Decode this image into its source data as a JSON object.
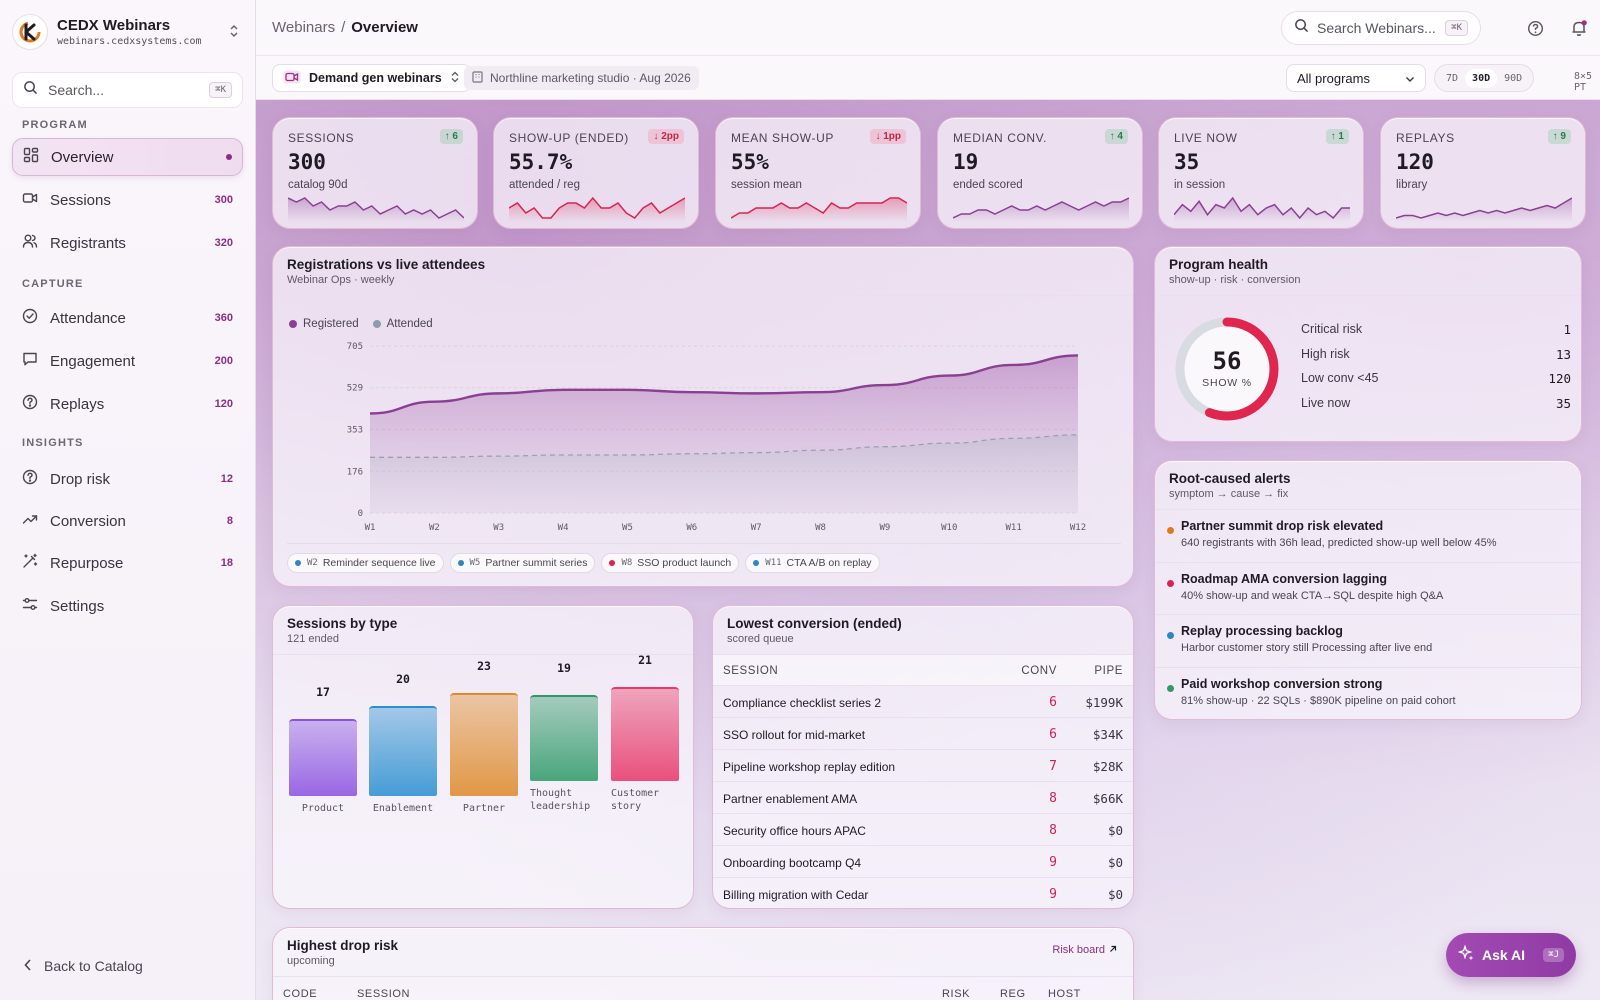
{
  "brand": {
    "name": "CEDX Webinars",
    "url": "webinars.cedxsystems.com"
  },
  "sidebar": {
    "search_placeholder": "Search...",
    "search_kbd": "⌘K",
    "sections": {
      "program": "PROGRAM",
      "capture": "CAPTURE",
      "insights": "INSIGHTS"
    },
    "items": [
      {
        "label": "Overview",
        "count": "",
        "icon": "grid-icon",
        "active": true
      },
      {
        "label": "Sessions",
        "count": "300",
        "icon": "video-icon"
      },
      {
        "label": "Registrants",
        "count": "320",
        "icon": "users-icon"
      },
      {
        "label": "Attendance",
        "count": "360",
        "icon": "check-circle-icon"
      },
      {
        "label": "Engagement",
        "count": "200",
        "icon": "chat-icon"
      },
      {
        "label": "Replays",
        "count": "120",
        "icon": "help-circle-icon"
      },
      {
        "label": "Drop risk",
        "count": "12",
        "icon": "help-circle-icon"
      },
      {
        "label": "Conversion",
        "count": "8",
        "icon": "trend-up-icon"
      },
      {
        "label": "Repurpose",
        "count": "18",
        "icon": "wand-icon"
      },
      {
        "label": "Settings",
        "count": "",
        "icon": "sliders-icon"
      }
    ],
    "back_label": "Back to Catalog"
  },
  "topbar": {
    "breadcrumb": [
      "Webinars",
      "Overview"
    ],
    "search_placeholder": "Search Webinars...",
    "search_kbd": "⌘K"
  },
  "subbar": {
    "workspace": "Demand gen webinars",
    "tenant": "Northline marketing studio · Aug 2026",
    "program_select": "All programs",
    "ranges": [
      "7D",
      "30D",
      "90D"
    ],
    "selected_range": "30D",
    "grid": "8×5 PT"
  },
  "kpis": [
    {
      "label": "SESSIONS",
      "value": "300",
      "caption": "catalog 90d",
      "delta": "↑ 6",
      "dir": "up",
      "color": "#8a3f93",
      "spark": [
        6,
        5,
        6,
        4,
        5,
        3,
        4,
        4,
        5,
        3,
        4,
        2,
        3,
        4,
        2,
        3,
        2,
        3,
        1,
        2,
        3,
        1
      ]
    },
    {
      "label": "SHOW-UP (ENDED)",
      "value": "55.7%",
      "caption": "attended / reg",
      "delta": "↓ 2pp",
      "dir": "down",
      "color": "#d8244e",
      "spark": [
        3,
        4,
        2,
        3,
        1,
        1,
        3,
        4,
        4,
        3,
        5,
        3,
        3,
        4,
        2,
        1,
        3,
        4,
        2,
        3,
        4,
        5
      ]
    },
    {
      "label": "MEAN SHOW-UP",
      "value": "55%",
      "caption": "session mean",
      "delta": "↓ 1pp",
      "dir": "down",
      "color": "#d8244e",
      "spark": [
        1,
        2,
        2,
        3,
        3,
        3,
        4,
        3,
        3,
        4,
        3,
        2,
        4,
        3,
        3,
        4,
        4,
        4,
        4,
        5,
        5,
        4
      ]
    },
    {
      "label": "MEDIAN CONV.",
      "value": "19",
      "caption": "ended scored",
      "delta": "↑ 4",
      "dir": "up",
      "color": "#8a3f93",
      "spark": [
        1,
        2,
        2,
        3,
        3,
        2,
        3,
        4,
        3,
        3,
        4,
        3,
        4,
        5,
        4,
        3,
        4,
        5,
        4,
        5,
        5,
        6
      ]
    },
    {
      "label": "LIVE NOW",
      "value": "35",
      "caption": "in session",
      "delta": "↑ 1",
      "dir": "up",
      "color": "#8a3f93",
      "spark": [
        2,
        5,
        3,
        6,
        2,
        5,
        4,
        7,
        3,
        5,
        2,
        4,
        5,
        2,
        4,
        1,
        4,
        2,
        3,
        1,
        4,
        4
      ]
    },
    {
      "label": "REPLAYS",
      "value": "120",
      "caption": "library",
      "delta": "↑ 9",
      "dir": "up",
      "color": "#8a3f93",
      "spark": [
        1,
        2,
        2,
        1,
        2,
        3,
        2,
        3,
        2,
        3,
        4,
        3,
        4,
        3,
        4,
        5,
        4,
        5,
        6,
        5,
        7,
        9
      ]
    }
  ],
  "registrations": {
    "title": "Registrations vs live attendees",
    "subtitle": "Webinar Ops · weekly",
    "annotations": [
      {
        "week": "W2",
        "label": "Reminder sequence live",
        "color": "#2a87c8"
      },
      {
        "week": "W5",
        "label": "Partner summit series",
        "color": "#2a87c8"
      },
      {
        "week": "W8",
        "label": "SSO product launch",
        "color": "#d8244e"
      },
      {
        "week": "W11",
        "label": "CTA A/B on replay",
        "color": "#2a87c8"
      }
    ]
  },
  "chart_data": [
    {
      "type": "area",
      "title": "Registrations vs live attendees",
      "x": [
        "W1",
        "W2",
        "W3",
        "W4",
        "W5",
        "W6",
        "W7",
        "W8",
        "W9",
        "W10",
        "W11",
        "W12"
      ],
      "ylim": [
        0,
        705
      ],
      "yticks": [
        0,
        176,
        353,
        529,
        705
      ],
      "legend_position": "top-left",
      "series": [
        {
          "name": "Registered",
          "color": "#8a3f93",
          "values": [
            420,
            470,
            505,
            520,
            520,
            510,
            505,
            510,
            540,
            580,
            625,
            665
          ]
        },
        {
          "name": "Attended",
          "color": "#8f9aae",
          "values": [
            235,
            235,
            240,
            245,
            245,
            250,
            255,
            265,
            280,
            295,
            315,
            330
          ]
        }
      ]
    },
    {
      "type": "bar",
      "title": "Sessions by type",
      "categories": [
        "Product",
        "Enablement",
        "Partner",
        "Thought leadership",
        "Customer story"
      ],
      "values": [
        17,
        20,
        23,
        19,
        21
      ],
      "colors": [
        "#8a52e0",
        "#2a8fd0",
        "#de8a2a",
        "#2f9a68",
        "#e83868"
      ]
    }
  ],
  "health": {
    "title": "Program health",
    "subtitle": "show-up · risk · conversion",
    "score": "56",
    "score_label": "SHOW %",
    "score_pct": 0.56,
    "rows": [
      {
        "label": "Critical risk",
        "value": "1"
      },
      {
        "label": "High risk",
        "value": "13"
      },
      {
        "label": "Low conv <45",
        "value": "120"
      },
      {
        "label": "Live now",
        "value": "35"
      }
    ]
  },
  "alerts": {
    "title": "Root-caused alerts",
    "subtitle": "symptom → cause → fix",
    "items": [
      {
        "title": "Partner summit drop risk elevated",
        "detail": "640 registrants with 36h lead, predicted show-up well below 45%",
        "color": "#e07a1c"
      },
      {
        "title": "Roadmap AMA conversion lagging",
        "detail": "40% show-up and weak CTA→SQL despite high Q&A",
        "color": "#d8244e"
      },
      {
        "title": "Replay processing backlog",
        "detail": "Harbor customer story still Processing after live end",
        "color": "#2a87c8"
      },
      {
        "title": "Paid workshop conversion strong",
        "detail": "81% show-up · 22 SQLs · $890K pipeline on paid cohort",
        "color": "#2f9a68"
      }
    ]
  },
  "sessions_by_type": {
    "title": "Sessions by type",
    "subtitle": "121 ended"
  },
  "lowest_conv": {
    "title": "Lowest conversion (ended)",
    "subtitle": "scored queue",
    "headers": [
      "SESSION",
      "CONV",
      "PIPE"
    ],
    "rows": [
      [
        "Compliance checklist series 2",
        "6",
        "$199K"
      ],
      [
        "SSO rollout for mid-market",
        "6",
        "$34K"
      ],
      [
        "Pipeline workshop replay edition",
        "7",
        "$28K"
      ],
      [
        "Partner enablement AMA",
        "8",
        "$66K"
      ],
      [
        "Security office hours APAC",
        "8",
        "$0"
      ],
      [
        "Onboarding bootcamp Q4",
        "9",
        "$0"
      ],
      [
        "Billing migration with Cedar",
        "9",
        "$0"
      ]
    ]
  },
  "drop_risk": {
    "title": "Highest drop risk",
    "subtitle": "upcoming",
    "link": "Risk board",
    "headers": [
      "CODE",
      "SESSION",
      "RISK",
      "REG",
      "HOST"
    ]
  },
  "ask_ai": {
    "label": "Ask AI",
    "kbd": "⌘J"
  }
}
